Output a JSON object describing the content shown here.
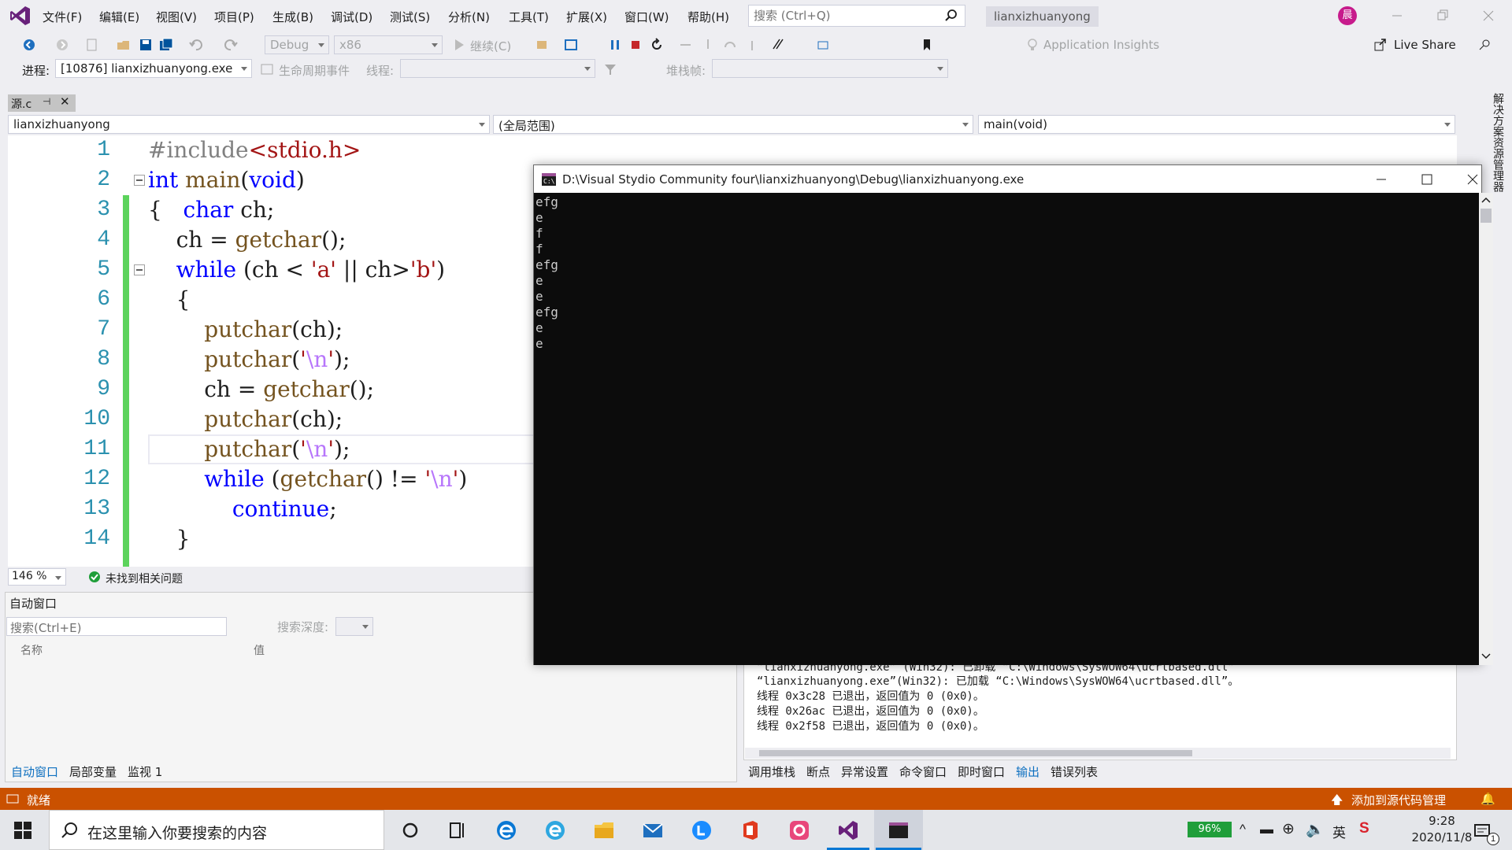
{
  "menu": {
    "items": [
      "文件(F)",
      "编辑(E)",
      "视图(V)",
      "项目(P)",
      "生成(B)",
      "调试(D)",
      "测试(S)",
      "分析(N)",
      "工具(T)",
      "扩展(X)",
      "窗口(W)",
      "帮助(H)"
    ],
    "search_placeholder": "搜索 (Ctrl+Q)",
    "project": "lianxizhuanyong",
    "avatar_initial": "晨"
  },
  "toolbar": {
    "config": "Debug",
    "platform": "x86",
    "continue_label": "继续(C)",
    "app_insights": "Application Insights",
    "live_share": "Live Share",
    "process_label": "进程:",
    "process_value": "[10876] lianxizhuanyong.exe",
    "lifecycle_label": "生命周期事件",
    "thread_label": "线程:",
    "stackframe_label": "堆栈帧:"
  },
  "editor": {
    "tab_label": "源.c",
    "nav_project": "lianxizhuanyong",
    "nav_scope": "(全局范围)",
    "nav_function": "main(void)",
    "line_numbers": [
      "1",
      "2",
      "3",
      "4",
      "5",
      "6",
      "7",
      "8",
      "9",
      "10",
      "11",
      "12",
      "13",
      "14"
    ],
    "zoom": "146 %",
    "issues": "未找到相关问题"
  },
  "solution_explorer_label": "解决方案资源管理器",
  "auto_window": {
    "title": "自动窗口",
    "search_placeholder": "搜索(Ctrl+E)",
    "search_depth": "搜索深度:",
    "col_name": "名称",
    "col_value": "值",
    "tabs": [
      "自动窗口",
      "局部变量",
      "监视 1"
    ]
  },
  "output": {
    "lines": [
      "“lianxizhuanyong.exe” (Win32): 已卸载 “C:\\Windows\\SysWOW64\\ucrtbased.dll”",
      "“lianxizhuanyong.exe”(Win32): 已加载 “C:\\Windows\\SysWOW64\\ucrtbased.dll”。",
      "线程 0x3c28 已退出，返回值为 0 (0x0)。",
      "线程 0x26ac 已退出，返回值为 0 (0x0)。",
      "线程 0x2f58 已退出，返回值为 0 (0x0)。"
    ],
    "tabs": [
      "调用堆栈",
      "断点",
      "异常设置",
      "命令窗口",
      "即时窗口",
      "输出",
      "错误列表"
    ]
  },
  "statusbar": {
    "ready": "就绪",
    "source_control": "添加到源代码管理"
  },
  "console": {
    "title": "D:\\Visual Stydio Community four\\lianxizhuanyong\\Debug\\lianxizhuanyong.exe",
    "output": "efg\ne\nf\nf\nefg\ne\ne\nefg\ne\ne"
  },
  "taskbar": {
    "search_placeholder": "在这里输入你要搜索的内容",
    "battery": "96%",
    "ime": "英",
    "time": "9:28",
    "date": "2020/11/8",
    "notification_count": "1"
  },
  "colors": {
    "statusbar": "#ca5100",
    "keyword": "#0000ff",
    "string": "#a31515",
    "line_number": "#2b91af",
    "change_bar": "#5cd35c"
  }
}
